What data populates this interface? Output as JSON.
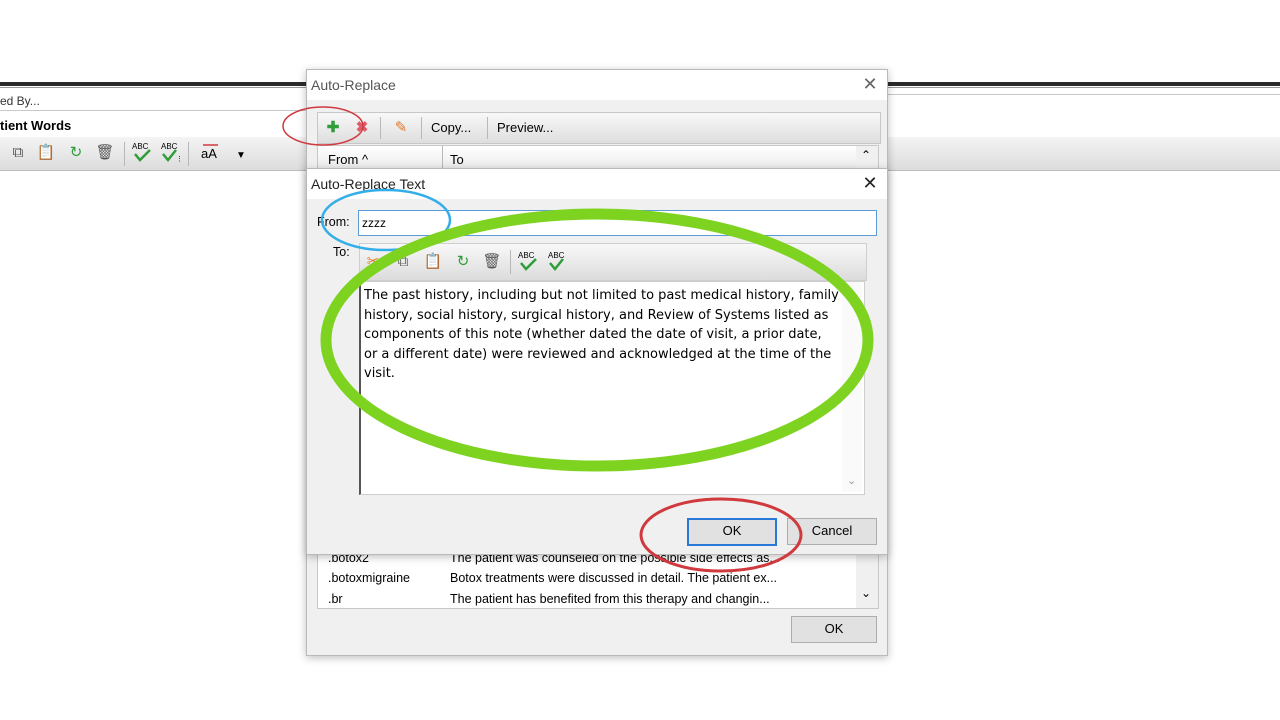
{
  "background": {
    "menu_partial": "ed By...",
    "section_partial": "tient Words"
  },
  "auto_replace": {
    "title": "Auto-Replace",
    "toolbar": {
      "copy_label": "Copy...",
      "preview_label": "Preview..."
    },
    "columns": {
      "from": "From",
      "to": "To"
    },
    "rows": [
      {
        "from": ".botox2",
        "to": "The patient was counseled on the possible side effects as..."
      },
      {
        "from": ".botoxmigraine",
        "to": "Botox treatments were discussed in detail. The patient ex..."
      },
      {
        "from": ".br",
        "to": "The patient has benefited from this therapy and changin..."
      }
    ],
    "ok_label": "OK"
  },
  "auto_replace_text": {
    "title": "Auto-Replace Text",
    "from_label": "From:",
    "from_value": "zzzz",
    "to_label": "To:",
    "to_text": "The past history, including but not limited to past medical history, family history, social history, surgical history, and Review of Systems listed as components of this note (whether dated the date of visit, a prior date, or a different date) were reviewed and acknowledged at the time of the visit.",
    "ok_label": "OK",
    "cancel_label": "Cancel"
  },
  "annotation_colors": {
    "red": "#d0393e",
    "blue": "#33aee8",
    "green": "#7ed321"
  },
  "icons": [
    "add-icon",
    "delete-icon",
    "edit-icon",
    "copy-icon",
    "paste-icon",
    "refresh-icon",
    "trash-icon",
    "spellcheck-icon",
    "spellcheck-all-icon",
    "font-case-icon",
    "dropdown-arrow-icon",
    "close-icon",
    "scroll-up-icon",
    "scroll-down-icon",
    "sort-ascending-icon"
  ]
}
